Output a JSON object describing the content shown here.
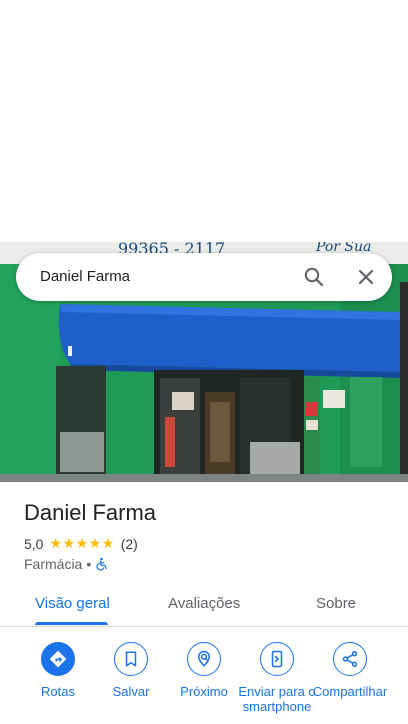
{
  "search": {
    "query": "Daniel Farma"
  },
  "photo": {
    "sign_numbers": "99365 - 2117",
    "sign_slogan": "Por Sua Saúde"
  },
  "place": {
    "name": "Daniel Farma",
    "rating": "5,0",
    "stars": "★★★★★",
    "review_count": "(2)",
    "category": "Farmácia",
    "separator": "•"
  },
  "tabs": [
    {
      "label": "Visão geral",
      "active": true
    },
    {
      "label": "Avaliações",
      "active": false
    },
    {
      "label": "Sobre",
      "active": false
    }
  ],
  "actions": [
    {
      "label": "Rotas",
      "icon": "directions-icon"
    },
    {
      "label": "Salvar",
      "icon": "bookmark-icon"
    },
    {
      "label": "Próximo",
      "icon": "nearby-icon"
    },
    {
      "label": "Enviar para o smartphone",
      "icon": "send-to-phone-icon"
    },
    {
      "label": "Compartilhar",
      "icon": "share-icon"
    }
  ],
  "colors": {
    "accent": "#1a73e8",
    "star": "#fbbc04",
    "awning": "#1e5fc9",
    "wall": "#1e9a55"
  }
}
